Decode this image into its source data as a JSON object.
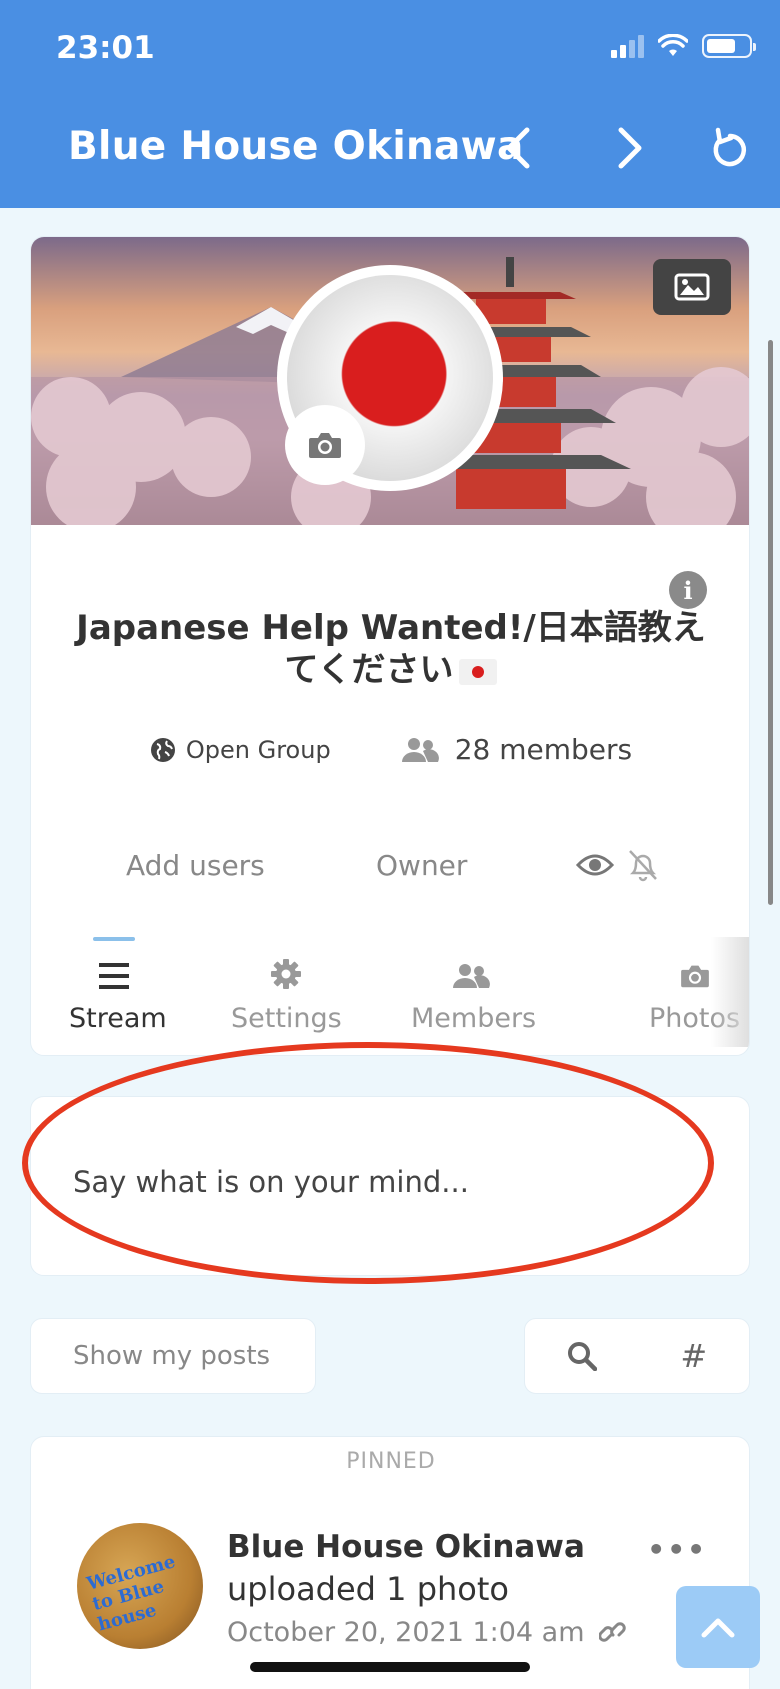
{
  "status_bar": {
    "time": "23:01"
  },
  "header": {
    "title": "Blue House Okinawa",
    "back_icon": "chevron-left-icon",
    "forward_icon": "chevron-right-icon",
    "reload_icon": "reload-icon"
  },
  "group": {
    "title": "Japanese Help Wanted!/日本語教えてください",
    "privacy": "Open Group",
    "members": "28 members",
    "actions": {
      "add_users": "Add users",
      "owner": "Owner"
    },
    "tabs": [
      {
        "label": "Stream",
        "icon": "list-icon"
      },
      {
        "label": "Settings",
        "icon": "gear-icon"
      },
      {
        "label": "Members",
        "icon": "users-icon"
      },
      {
        "label": "Photos",
        "icon": "camera-icon"
      }
    ]
  },
  "composer": {
    "placeholder": "Say what is on your mind..."
  },
  "filters": {
    "show_my_posts": "Show my posts",
    "hashtag": "#"
  },
  "post": {
    "pinned_label": "PINNED",
    "author": "Blue House Okinawa",
    "action": "uploaded 1 photo",
    "date": "October 20, 2021 1:04 am",
    "avatar_text": "Welcome to Blue house"
  },
  "colors": {
    "header_bg": "#4a8fe3",
    "annotation_circle": "#e5391f",
    "scroll_top_bg": "#9ccbf6"
  }
}
